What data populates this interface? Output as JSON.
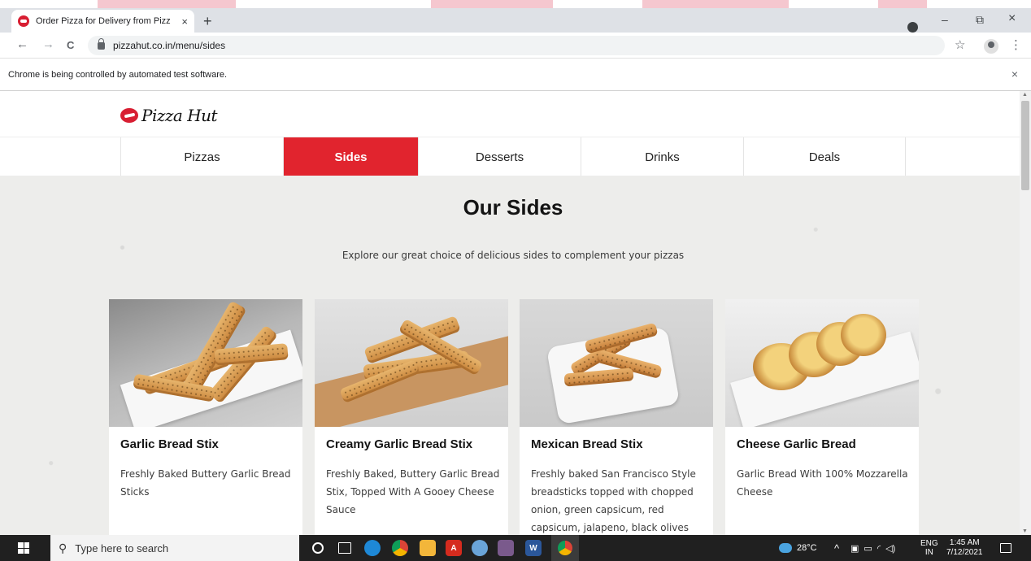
{
  "browser": {
    "tab_title": "Order Pizza for Delivery from Pizz",
    "tab_close": "×",
    "new_tab": "+",
    "url": "pizzahut.co.in/menu/sides",
    "infobar_message": "Chrome is being controlled by automated test software.",
    "infobar_close": "×",
    "window_controls": {
      "minimize": "–",
      "restore": "⧉",
      "close": "×"
    },
    "nav": {
      "back": "←",
      "forward": "→",
      "reload": "C"
    },
    "star": "☆",
    "menu": "⋮"
  },
  "site": {
    "logo_text": "Pizza Hut",
    "nav_items": [
      {
        "label": "Pizzas",
        "active": false
      },
      {
        "label": "Sides",
        "active": true
      },
      {
        "label": "Desserts",
        "active": false
      },
      {
        "label": "Drinks",
        "active": false
      },
      {
        "label": "Deals",
        "active": false
      }
    ],
    "section_title": "Our Sides",
    "section_subtitle": "Explore our great choice of delicious sides to complement your pizzas",
    "products": [
      {
        "name": "Garlic Bread Stix",
        "description": "Freshly Baked Buttery Garlic Bread Sticks"
      },
      {
        "name": "Creamy Garlic Bread Stix",
        "description": "Freshly Baked, Buttery Garlic Bread Stix, Topped With A Gooey Cheese Sauce"
      },
      {
        "name": "Mexican Bread Stix",
        "description": "Freshly baked San Francisco Style breadsticks topped with chopped onion, green capsicum, red capsicum, jalapeno, black olives"
      },
      {
        "name": "Cheese Garlic Bread",
        "description": "Garlic Bread With 100% Mozzarella Cheese"
      }
    ]
  },
  "taskbar": {
    "search_placeholder": "Type here to search",
    "temperature": "28°C",
    "language_top": "ENG",
    "language_bottom": "IN",
    "time": "1:45 AM",
    "date": "7/12/2021"
  },
  "colors": {
    "brand_red": "#e1242e",
    "tab_bar": "#dee1e6",
    "taskbar": "#202020"
  }
}
